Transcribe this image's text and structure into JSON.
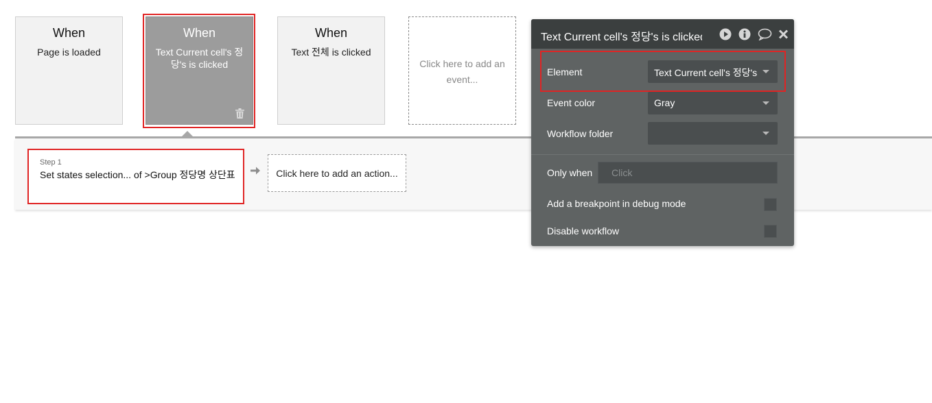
{
  "events": [
    {
      "when": "When",
      "description": "Page is loaded"
    },
    {
      "when": "When",
      "description": "Text Current cell's 정당's is clicked"
    },
    {
      "when": "When",
      "description": "Text 전체 is clicked"
    }
  ],
  "add_event_label": "Click here to add an event...",
  "workflow": {
    "step_label": "Step 1",
    "step_title": "Set states selection... of >Group 정당명 상단표",
    "add_action_label": "Click here to add an action..."
  },
  "panel": {
    "title": "Text Current cell's 정당's is clicked",
    "element_label": "Element",
    "element_value": "Text Current cell's 정당's",
    "event_color_label": "Event color",
    "event_color_value": "Gray",
    "workflow_folder_label": "Workflow folder",
    "workflow_folder_value": "",
    "only_when_label": "Only when",
    "only_when_placeholder": "Click",
    "breakpoint_label": "Add a breakpoint in debug mode",
    "disable_label": "Disable workflow"
  },
  "icons": {
    "delete": "trash-icon",
    "arrow": "arrow-right-icon",
    "run": "play-icon",
    "info": "info-icon",
    "comment": "comment-icon",
    "close": "close-icon"
  },
  "colors": {
    "highlight": "#e02424",
    "selected_card": "#9c9c9c",
    "panel_bg": "#5f6363",
    "panel_header": "#3b3f3f"
  }
}
